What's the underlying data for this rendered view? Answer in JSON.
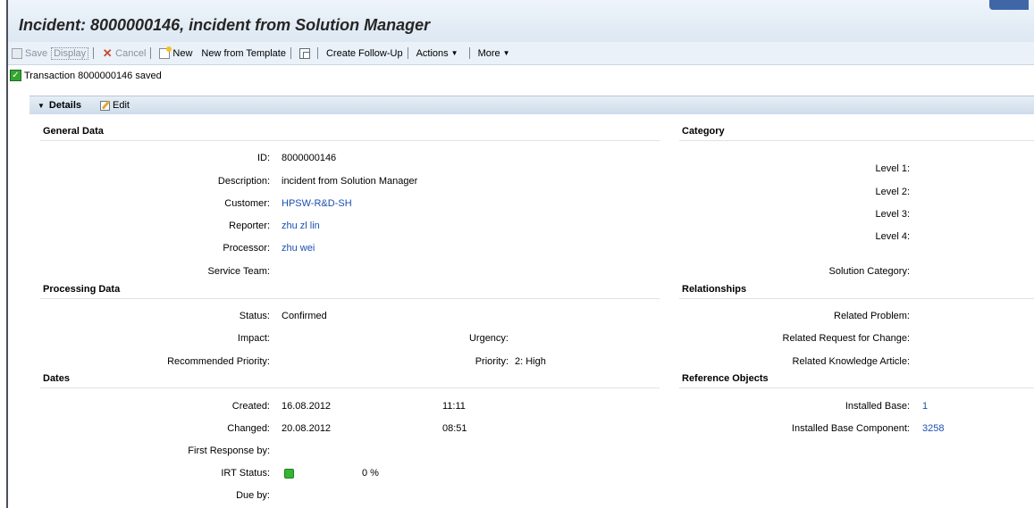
{
  "header": {
    "title": "Incident: 8000000146, incident from Solution Manager"
  },
  "toolbar": {
    "save": "Save",
    "display": "Display",
    "cancel": "Cancel",
    "new": "New",
    "new_from_template": "New from Template",
    "create_follow_up": "Create Follow-Up",
    "actions": "Actions",
    "more": "More"
  },
  "status_message": "Transaction 8000000146 saved",
  "details": {
    "title": "Details",
    "edit": "Edit"
  },
  "general_data": {
    "title": "General Data",
    "id_label": "ID:",
    "id_value": "8000000146",
    "description_label": "Description:",
    "description_value": "incident from Solution Manager",
    "customer_label": "Customer:",
    "customer_value": "HPSW-R&D-SH",
    "reporter_label": "Reporter:",
    "reporter_value": "zhu zl lin",
    "processor_label": "Processor:",
    "processor_value": "zhu wei",
    "service_team_label": "Service Team:"
  },
  "processing_data": {
    "title": "Processing Data",
    "status_label": "Status:",
    "status_value": "Confirmed",
    "impact_label": "Impact:",
    "urgency_label": "Urgency:",
    "recommended_priority_label": "Recommended Priority:",
    "priority_label": "Priority:",
    "priority_value": "2: High"
  },
  "dates": {
    "title": "Dates",
    "created_label": "Created:",
    "created_date": "16.08.2012",
    "created_time": "11:11",
    "changed_label": "Changed:",
    "changed_date": "20.08.2012",
    "changed_time": "08:51",
    "first_response_label": "First Response by:",
    "irt_status_label": "IRT Status:",
    "irt_status_percent": "0 %",
    "due_by_label": "Due by:"
  },
  "category": {
    "title": "Category",
    "level1_label": "Level 1:",
    "level2_label": "Level 2:",
    "level3_label": "Level 3:",
    "level4_label": "Level 4:",
    "solution_category_label": "Solution Category:"
  },
  "relationships": {
    "title": "Relationships",
    "related_problem_label": "Related Problem:",
    "related_rfc_label": "Related Request for Change:",
    "related_ka_label": "Related Knowledge Article:"
  },
  "reference_objects": {
    "title": "Reference Objects",
    "installed_base_label": "Installed Base:",
    "installed_base_value": "1",
    "installed_base_component_label": "Installed Base Component:",
    "installed_base_component_value": "3258"
  }
}
